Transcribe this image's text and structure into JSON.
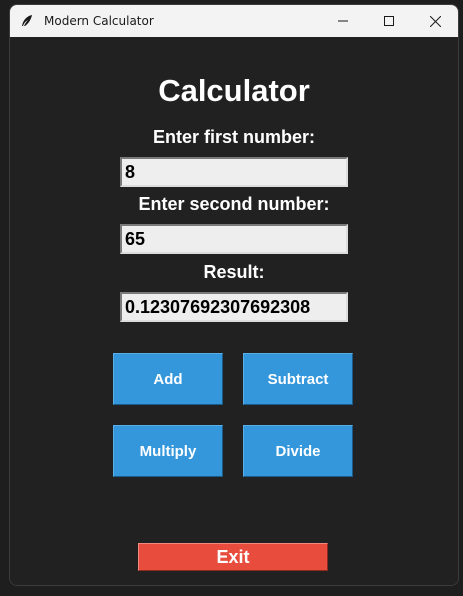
{
  "window": {
    "title": "Modern Calculator",
    "icon": "feather-icon"
  },
  "main": {
    "heading": "Calculator",
    "first_label": "Enter first number:",
    "first_value": "8",
    "second_label": "Enter second number:",
    "second_value": "65",
    "result_label": "Result:",
    "result_value": "0.12307692307692308"
  },
  "buttons": {
    "add": "Add",
    "subtract": "Subtract",
    "multiply": "Multiply",
    "divide": "Divide",
    "exit": "Exit"
  },
  "colors": {
    "background": "#212121",
    "op_button": "#3496db",
    "exit_button": "#e74c3c",
    "text": "#ffffff"
  }
}
